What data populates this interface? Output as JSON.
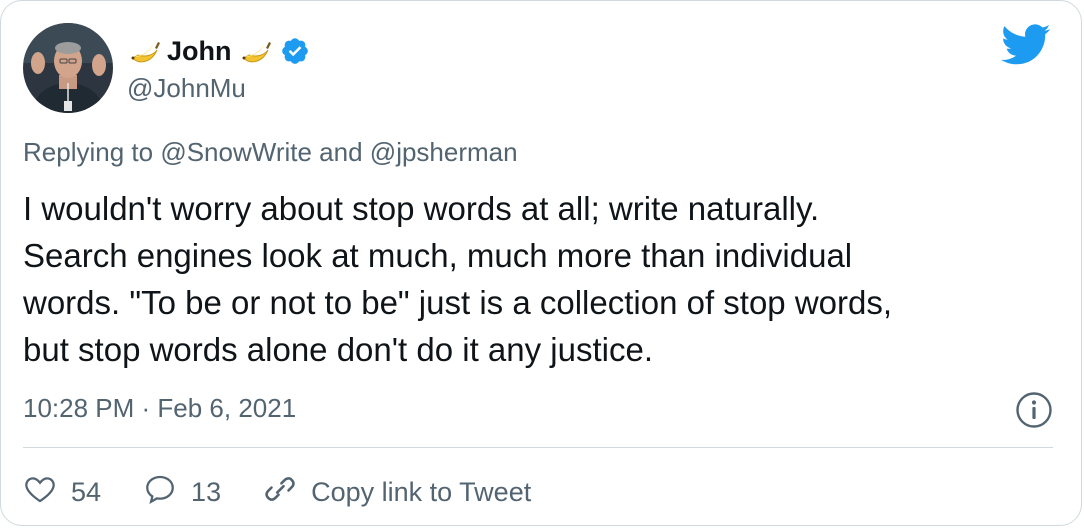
{
  "tweet": {
    "display_name": "John",
    "handle": "@JohnMu",
    "replying_prefix": "Replying to",
    "reply_mention_1": "@SnowWrite",
    "reply_joiner": "and",
    "reply_mention_2": "@jpsherman",
    "text": "I wouldn't worry about stop words at all; write naturally.\nSearch engines look at much, much more than individual\nwords. \"To be or not to be\" just is a collection of stop words,\nbut stop words alone don't do it any justice.",
    "timestamp": "10:28 PM · Feb 6, 2021"
  },
  "actions": {
    "like_count": "54",
    "reply_count": "13",
    "copy_link_label": "Copy link to Tweet"
  },
  "icons": {
    "brand": "twitter-bird-icon",
    "verified": "verified-badge-icon",
    "name_emoji": "banana-icon",
    "like": "heart-icon",
    "reply": "speech-bubble-icon",
    "copy_link": "link-icon",
    "info": "info-icon"
  },
  "colors": {
    "brand_blue": "#1d9bf0",
    "text_primary": "#0f1419",
    "text_secondary": "#536471",
    "border": "#cfd9de"
  }
}
